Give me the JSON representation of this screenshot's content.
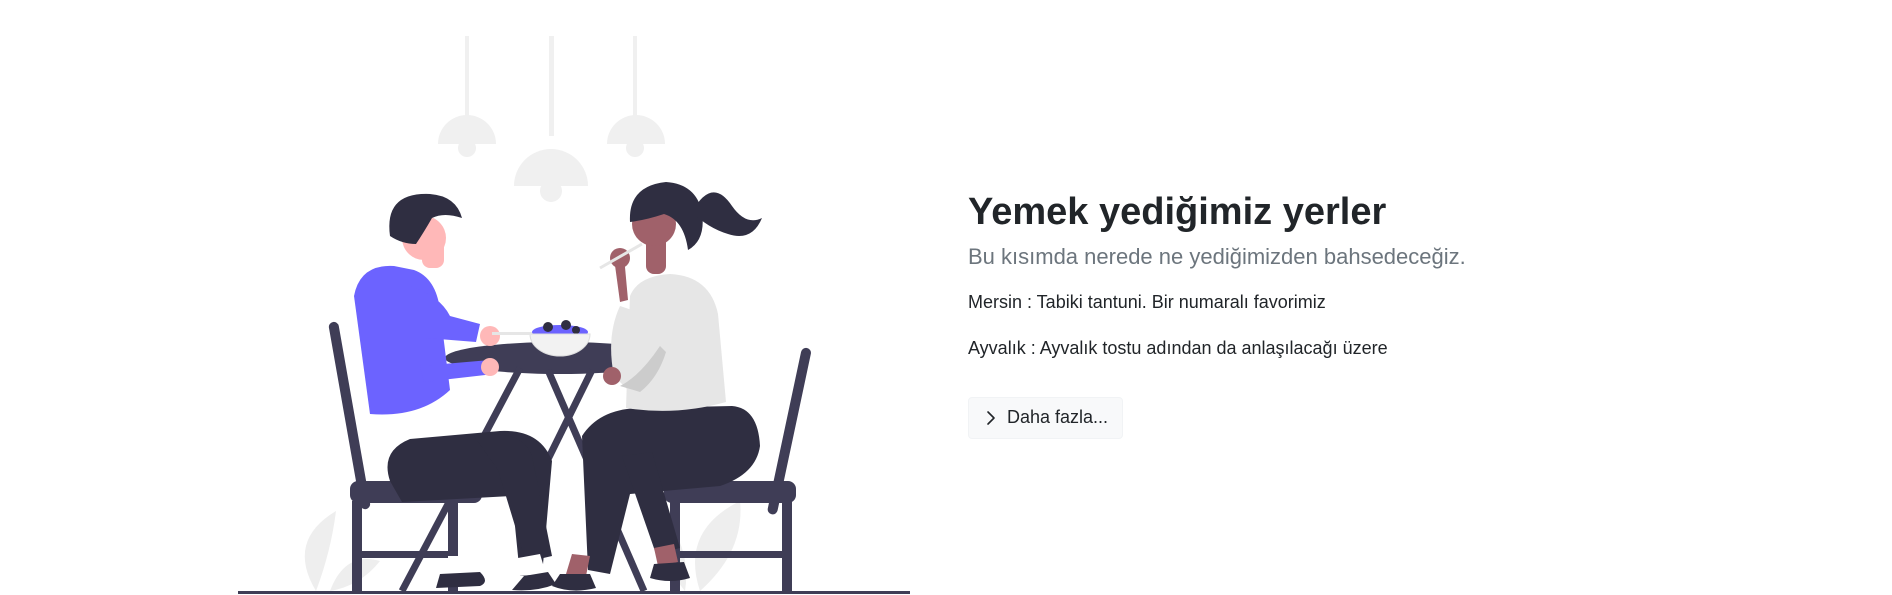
{
  "feature": {
    "title": "Yemek yediğimiz yerler",
    "lead": "Bu kısımda nerede ne yediğimizden bahsedeceğiz.",
    "items": [
      "Mersin : Tabiki tantuni. Bir numaralı favorimiz",
      "Ayvalık : Ayvalık tostu adından da anlaşılacağı üzere"
    ],
    "more_button": {
      "label": "Daha fazla...",
      "icon": "chevron-right-icon"
    }
  },
  "illustration": {
    "icon": "people-dining-illustration",
    "colors": {
      "accent": "#6c63ff",
      "dark": "#2f2e41",
      "chair": "#3f3d56",
      "light": "#f2f2f2",
      "skin_light": "#ffb8b8",
      "skin_dark": "#a0616a"
    }
  }
}
